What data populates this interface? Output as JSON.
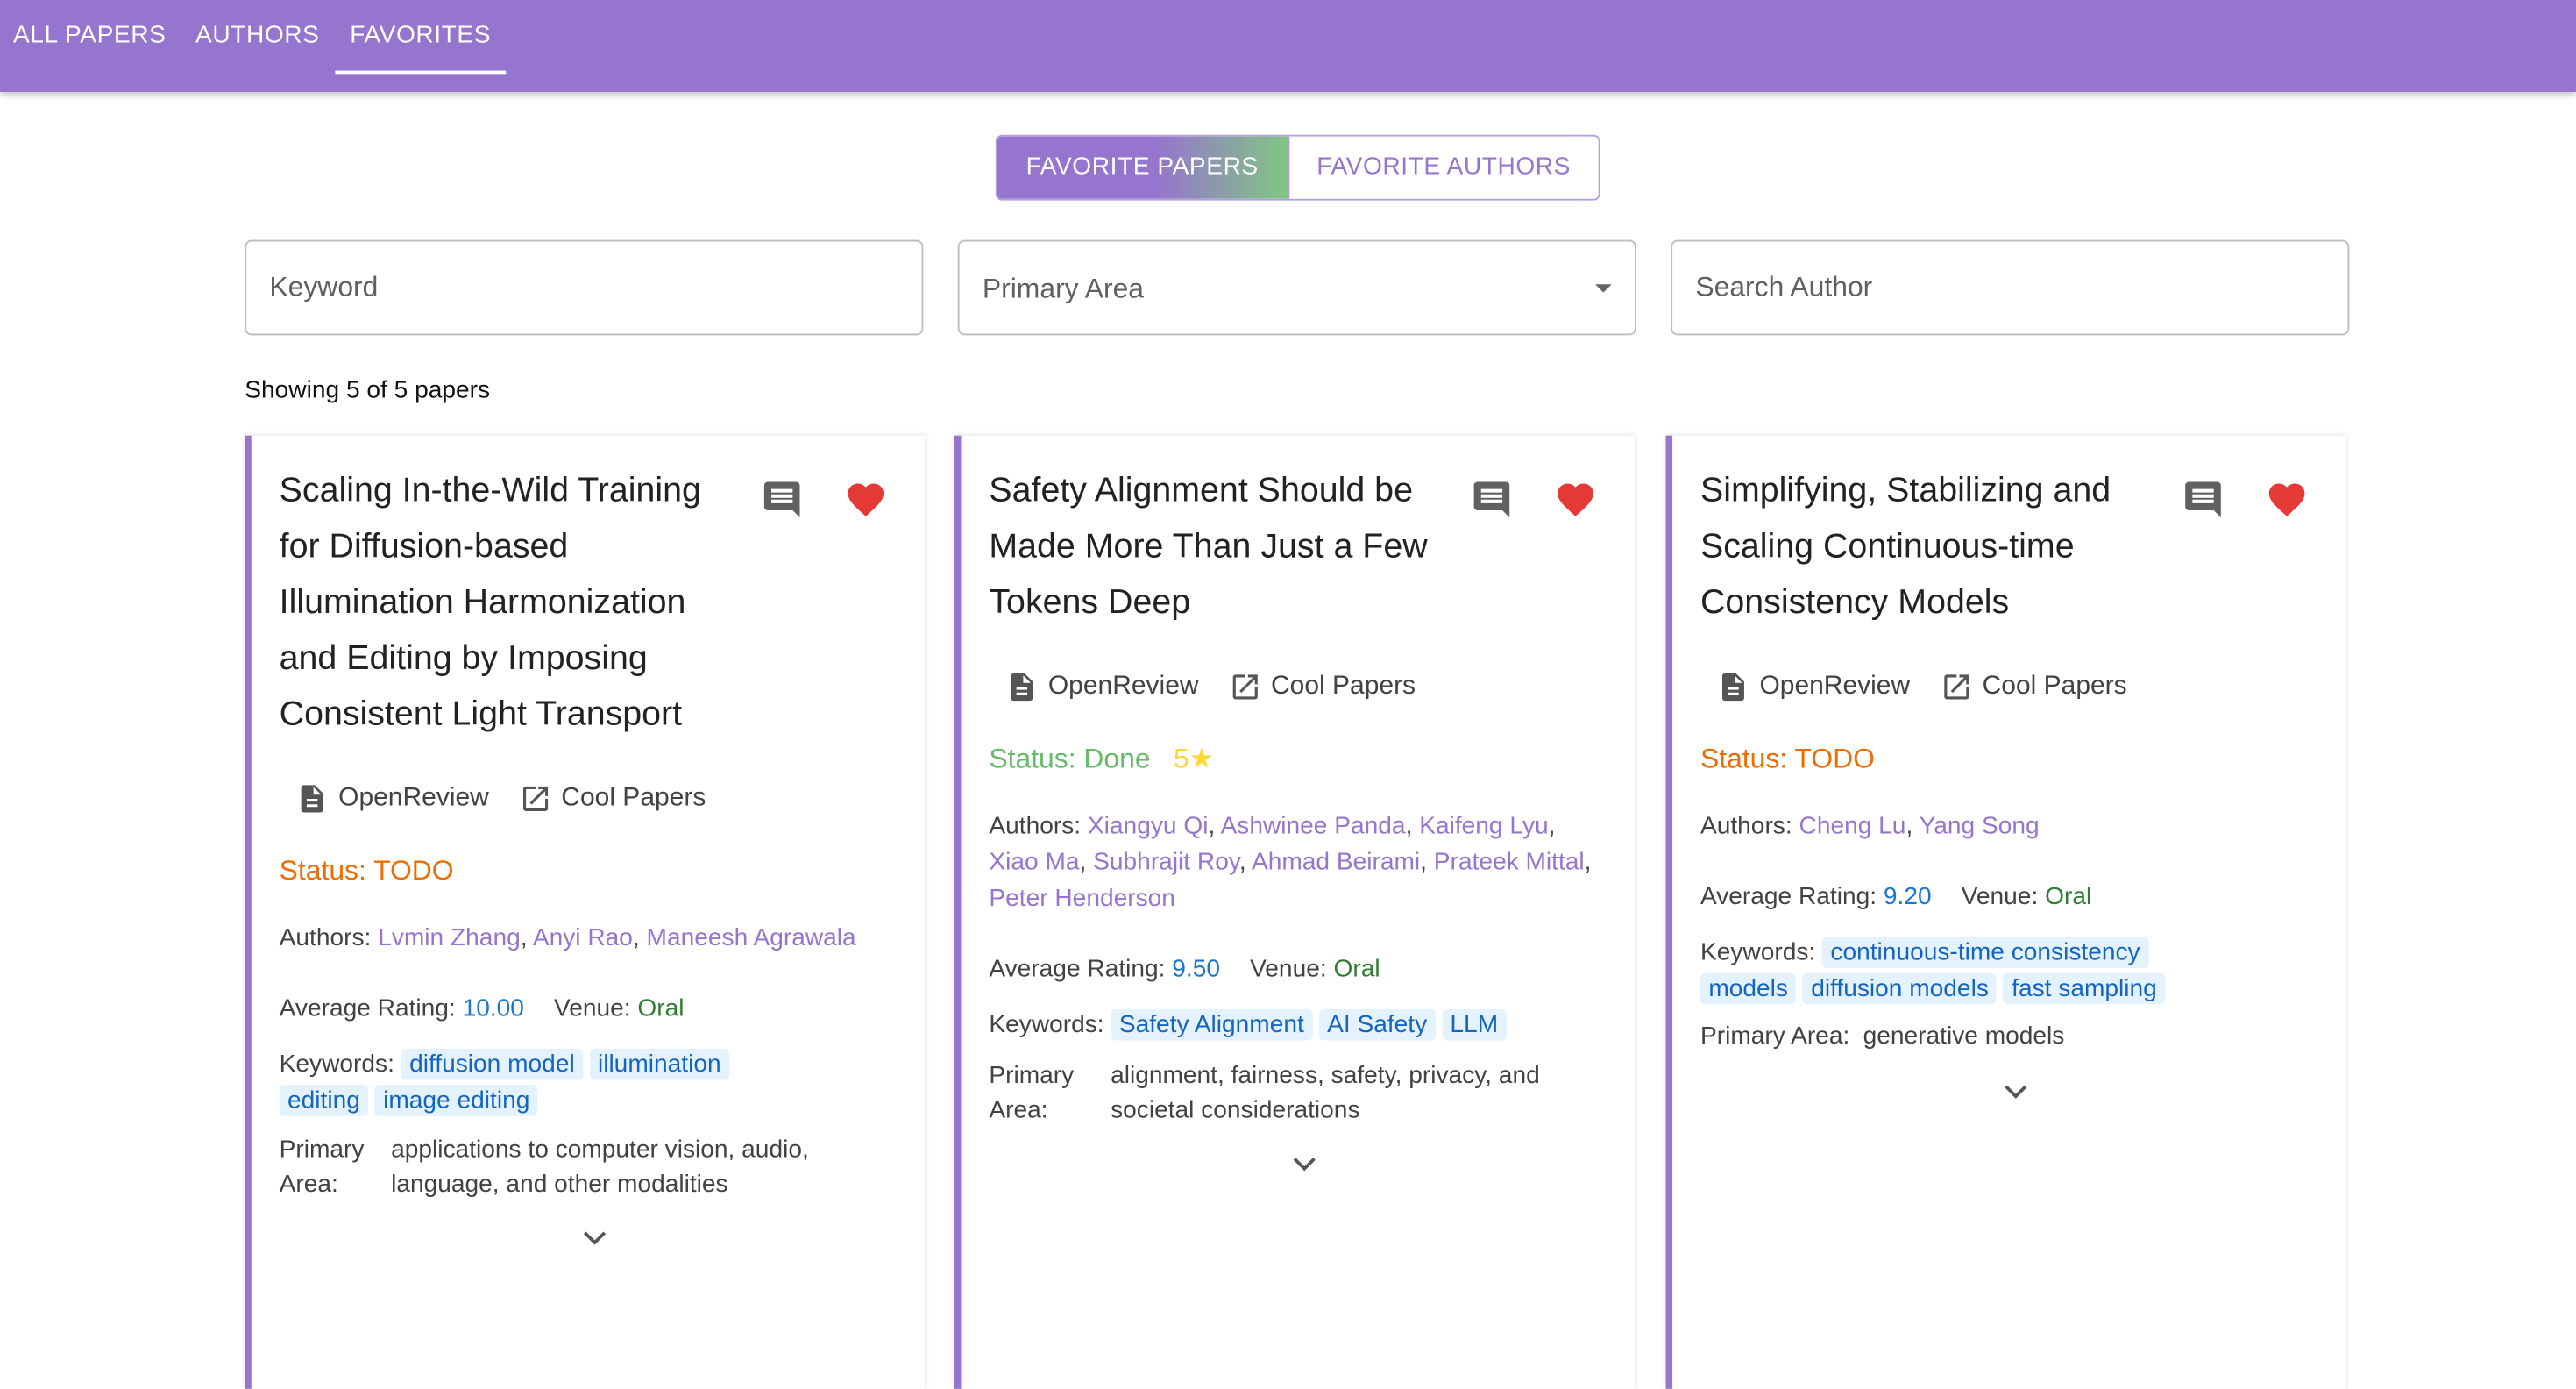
{
  "nav": {
    "tabs": [
      "ALL PAPERS",
      "AUTHORS",
      "FAVORITES"
    ],
    "active": "FAVORITES"
  },
  "toggle": {
    "papers": "FAVORITE PAPERS",
    "authors": "FAVORITE AUTHORS",
    "active": "FAVORITE PAPERS"
  },
  "filters": {
    "keyword_placeholder": "Keyword",
    "primary_area_label": "Primary Area",
    "author_placeholder": "Search Author"
  },
  "results_count": "Showing 5 of 5 papers",
  "labels": {
    "openreview": "OpenReview",
    "coolpapers": "Cool Papers",
    "authors": "Authors:",
    "avg_rating": "Average Rating:",
    "venue": "Venue:",
    "keywords": "Keywords:",
    "primary": "Primary",
    "area": "Area:",
    "primary_area": "Primary Area:"
  },
  "colors": {
    "primary": "#9575cd",
    "todo": "#ef6c00",
    "done": "#66bb6a",
    "heart": "#e53935",
    "rating": "#1976d2",
    "venue": "#2e7d32"
  },
  "papers": [
    {
      "title_lines": [
        "Scaling In-the-Wild Training",
        "for Diffusion-based",
        "Illumination Harmonization",
        "and Editing by Imposing",
        "Consistent Light Transport"
      ],
      "status": "Status: TODO",
      "authors": [
        "Lvmin Zhang",
        "Anyi Rao",
        "Maneesh Agrawala"
      ],
      "rating": "10.00",
      "venue": "Oral",
      "keywords_line1": [
        "diffusion model",
        "illumination"
      ],
      "keywords_line2": [
        "editing",
        "image editing"
      ],
      "primary_area_lines": [
        "applications to computer vision, audio,",
        "language, and other modalities"
      ]
    },
    {
      "title_lines": [
        "Safety Alignment Should be",
        "Made More Than Just a Few",
        "Tokens Deep"
      ],
      "status": "Status: Done",
      "stars": "5★",
      "authors_line1": [
        "Xiangyu Qi",
        "Ashwinee Panda",
        "Kaifeng Lyu"
      ],
      "authors_line2": [
        "Xiao Ma",
        "Subhrajit Roy",
        "Ahmad Beirami",
        "Prateek Mittal"
      ],
      "authors_line3": [
        "Peter Henderson"
      ],
      "rating": "9.50",
      "venue": "Oral",
      "keywords": [
        "Safety Alignment",
        "AI Safety",
        "LLM"
      ],
      "primary_area_lines": [
        "alignment, fairness, safety, privacy, and",
        "societal considerations"
      ]
    },
    {
      "title_lines": [
        "Simplifying, Stabilizing and",
        "Scaling Continuous-time",
        "Consistency Models"
      ],
      "status": "Status: TODO",
      "authors": [
        "Cheng Lu",
        "Yang Song"
      ],
      "rating": "9.20",
      "venue": "Oral",
      "keywords_line1": [
        "continuous-time consistency"
      ],
      "keywords_line2": [
        "models",
        "diffusion models",
        "fast sampling"
      ],
      "primary_area": "generative models"
    }
  ]
}
